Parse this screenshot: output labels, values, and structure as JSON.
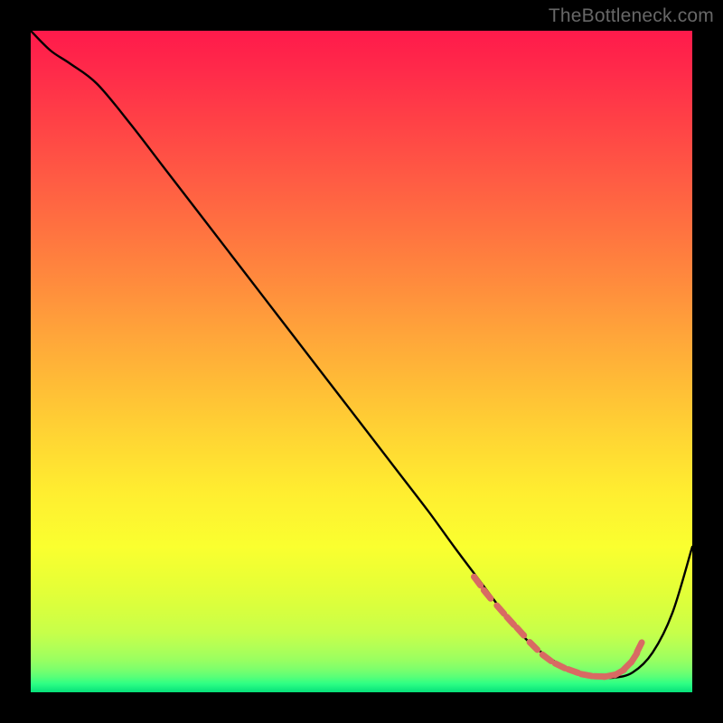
{
  "watermark": "TheBottleneck.com",
  "chart_data": {
    "type": "line",
    "title": "",
    "xlabel": "",
    "ylabel": "",
    "xlim": [
      0,
      100
    ],
    "ylim": [
      0,
      100
    ],
    "grid": false,
    "series": [
      {
        "name": "bottleneck-curve",
        "x": [
          0,
          3,
          6,
          10,
          15,
          20,
          25,
          30,
          35,
          40,
          45,
          50,
          55,
          60,
          64,
          67,
          70,
          73,
          76,
          79,
          82,
          85,
          88,
          91,
          94,
          97,
          100
        ],
        "y": [
          100,
          97,
          95,
          92,
          86,
          79.5,
          73,
          66.5,
          60,
          53.5,
          47,
          40.5,
          34,
          27.5,
          22,
          18,
          14,
          10,
          7,
          4.8,
          3.2,
          2.4,
          2.2,
          3.0,
          6.0,
          12,
          22
        ]
      }
    ],
    "markers": {
      "name": "sweet-spot",
      "color": "#d86a63",
      "x": [
        67.5,
        69,
        71,
        72.5,
        74,
        76,
        78,
        80,
        82,
        84,
        86,
        87.5,
        89,
        90.2,
        91.2,
        92
      ],
      "y": [
        16.8,
        14.8,
        12.5,
        10.8,
        9.2,
        7.0,
        5.2,
        4.0,
        3.2,
        2.6,
        2.4,
        2.5,
        3.0,
        4.0,
        5.2,
        6.8
      ]
    },
    "background_gradient": {
      "top": "#ff1a4b",
      "mid": "#ffd733",
      "bottom": "#06e07a"
    }
  }
}
